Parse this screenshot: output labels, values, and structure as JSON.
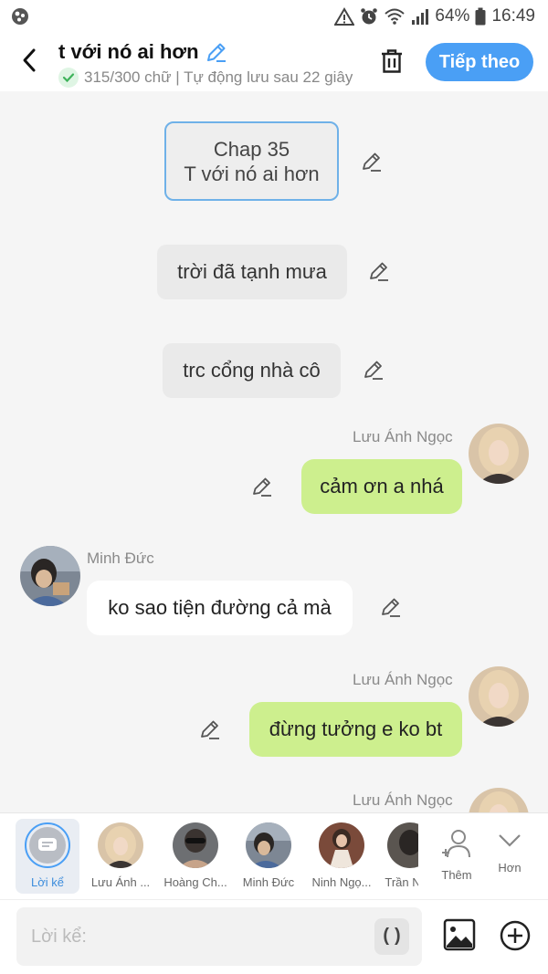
{
  "status": {
    "battery": "64%",
    "time": "16:49"
  },
  "header": {
    "title": "t với nó ai hơn",
    "subtitle": "315/300 chữ | Tự động lưu sau 22 giây",
    "next_label": "Tiếp theo"
  },
  "chat": {
    "chap_line1": "Chap 35",
    "chap_line2": "T với nó ai hơn",
    "narration1": "trời đã tạnh mưa",
    "narration2": "trc cổng nhà cô",
    "name_luu1": "Lưu Ánh Ngọc",
    "msg1": "cảm ơn a nhá",
    "name_minh": "Minh Đức",
    "msg2": "ko sao tiện đường cả mà",
    "name_luu2": "Lưu Ánh Ngọc",
    "msg3": "đừng tưởng e ko bt",
    "name_luu3": "Lưu Ánh Ngọc"
  },
  "characters": {
    "narrator": "Lời kể",
    "c1": "Lưu Ánh ...",
    "c2": "Hoàng Ch...",
    "c3": "Minh Đức",
    "c4": "Ninh Ngọ...",
    "c5": "Trần N",
    "more": "Thêm",
    "collapse": "Hơn"
  },
  "input": {
    "placeholder": "Lời kể:",
    "paren": "()"
  }
}
